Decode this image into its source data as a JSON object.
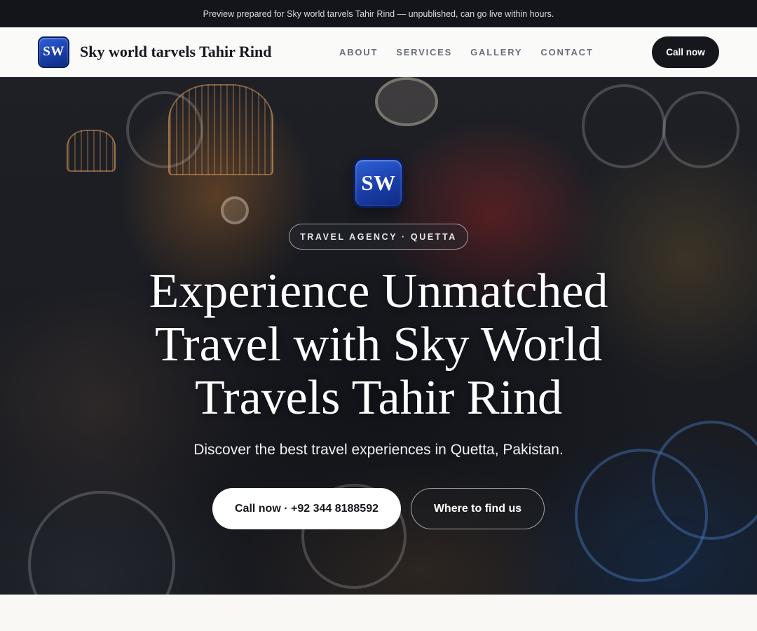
{
  "announcement": "Preview prepared for Sky world tarvels Tahir Rind — unpublished, can go live within hours.",
  "brand": {
    "logo_text": "SW",
    "name": "Sky world tarvels Tahir Rind"
  },
  "nav": {
    "items": [
      {
        "label": "ABOUT"
      },
      {
        "label": "SERVICES"
      },
      {
        "label": "GALLERY"
      },
      {
        "label": "CONTACT"
      }
    ],
    "cta_label": "Call now"
  },
  "hero": {
    "logo_text": "SW",
    "tag": "TRAVEL AGENCY · QUETTA",
    "title": "Experience Unmatched Travel with Sky World Travels Tahir Rind",
    "subtitle": "Discover the best travel experiences in Quetta, Pakistan.",
    "primary_button": "Call now · +92 344 8188592",
    "secondary_button": "Where to find us"
  },
  "colors": {
    "dark": "#15171c",
    "logo_blue": "#1a3ea8",
    "light_bg": "#fafaf8"
  }
}
